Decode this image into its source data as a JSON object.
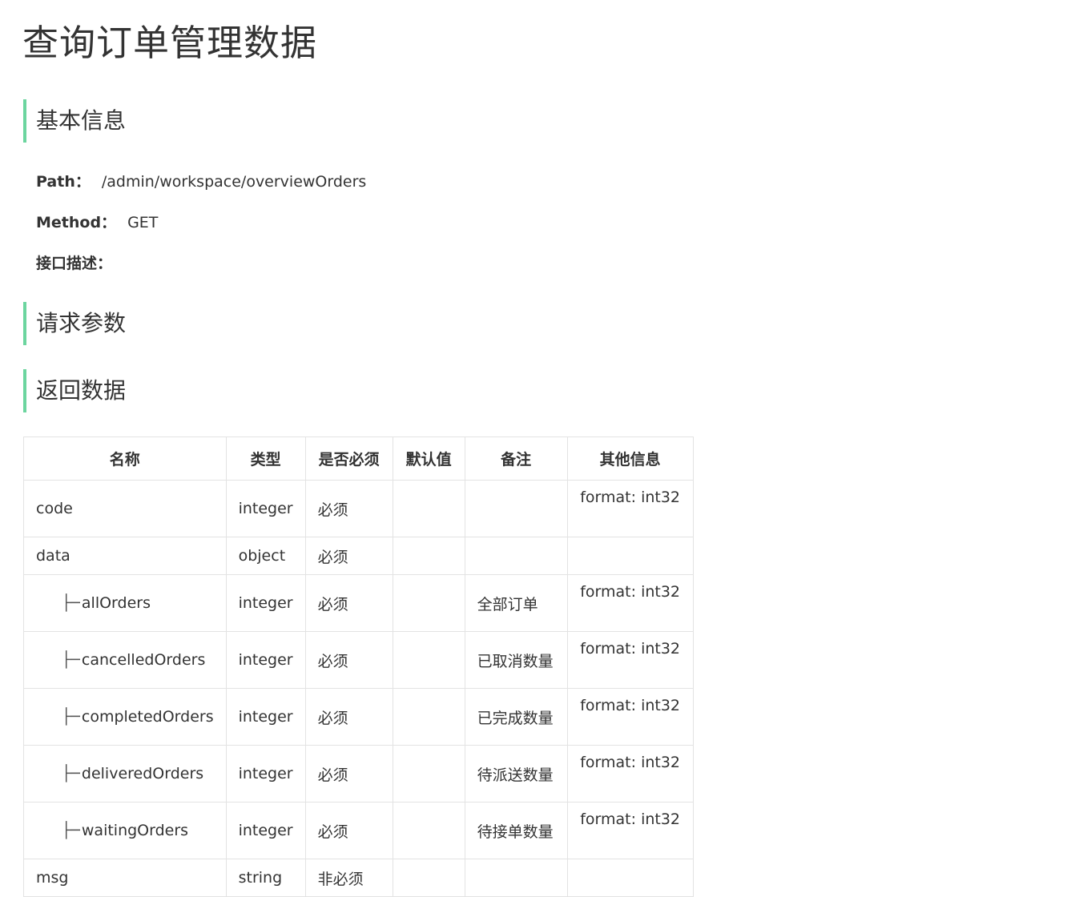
{
  "title": "查询订单管理数据",
  "sections": {
    "basic": "基本信息",
    "request": "请求参数",
    "response": "返回数据"
  },
  "info": {
    "path_label": "Path：",
    "path_value": "/admin/workspace/overviewOrders",
    "method_label": "Method：",
    "method_value": "GET",
    "desc_label": "接口描述："
  },
  "table": {
    "headers": [
      "名称",
      "类型",
      "是否必须",
      "默认值",
      "备注",
      "其他信息"
    ],
    "tree_prefix": "├─",
    "rows": [
      {
        "name": "code",
        "type": "integer",
        "required": "必须",
        "default": "",
        "note": "",
        "other": "format: int32"
      },
      {
        "name": "data",
        "type": "object",
        "required": "必须",
        "default": "",
        "note": "",
        "other": ""
      },
      {
        "name": "allOrders",
        "type": "integer",
        "required": "必须",
        "default": "",
        "note": "全部订单",
        "other": "format: int32"
      },
      {
        "name": "cancelledOrders",
        "type": "integer",
        "required": "必须",
        "default": "",
        "note": "已取消数量",
        "other": "format: int32"
      },
      {
        "name": "completedOrders",
        "type": "integer",
        "required": "必须",
        "default": "",
        "note": "已完成数量",
        "other": "format: int32"
      },
      {
        "name": "deliveredOrders",
        "type": "integer",
        "required": "必须",
        "default": "",
        "note": "待派送数量",
        "other": "format: int32"
      },
      {
        "name": "waitingOrders",
        "type": "integer",
        "required": "必须",
        "default": "",
        "note": "待接单数量",
        "other": "format: int32"
      },
      {
        "name": "msg",
        "type": "string",
        "required": "非必须",
        "default": "",
        "note": "",
        "other": ""
      }
    ]
  }
}
